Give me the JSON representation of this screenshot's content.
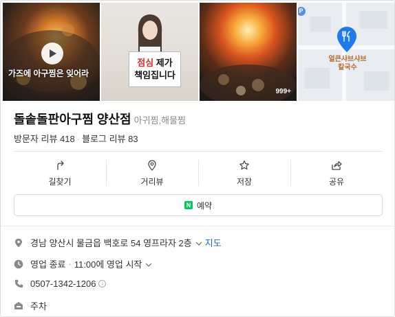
{
  "photos": {
    "video_caption": "가즈에 아구찜은 잊어라",
    "sign_line1_red": "점심",
    "sign_line1_rest": " 제가",
    "sign_line2": "책임집니다",
    "photo_count": "999+",
    "map_badge": "P",
    "map_pin_label_1": "얼큰샤브샤브",
    "map_pin_label_2": "칼국수"
  },
  "place": {
    "name": "돌솥돌판아구찜 양산점",
    "category": "아귀찜,해물찜",
    "visitor_reviews_label": "방문자 리뷰",
    "visitor_reviews_count": "418",
    "blog_reviews_label": "블로그 리뷰",
    "blog_reviews_count": "83"
  },
  "actions": [
    {
      "label": "길찾기",
      "icon": "directions-icon"
    },
    {
      "label": "거리뷰",
      "icon": "location-pin-icon"
    },
    {
      "label": "저장",
      "icon": "star-icon"
    },
    {
      "label": "공유",
      "icon": "share-icon"
    }
  ],
  "reserve": {
    "badge": "N",
    "label": "예약"
  },
  "info": {
    "address": "경남 양산시 물금읍 백호로 54 영프라자 2층",
    "map_link": "지도",
    "hours_status": "영업 종료",
    "hours_sep": "·",
    "hours_next": "11:00에 영업 시작",
    "phone": "0507-1342-1206",
    "phone_info": "i",
    "parking": "주차"
  },
  "colors": {
    "accent_blue": "#1a63d6",
    "naver_green": "#03c75a",
    "map_pin": "#1f7bea"
  }
}
